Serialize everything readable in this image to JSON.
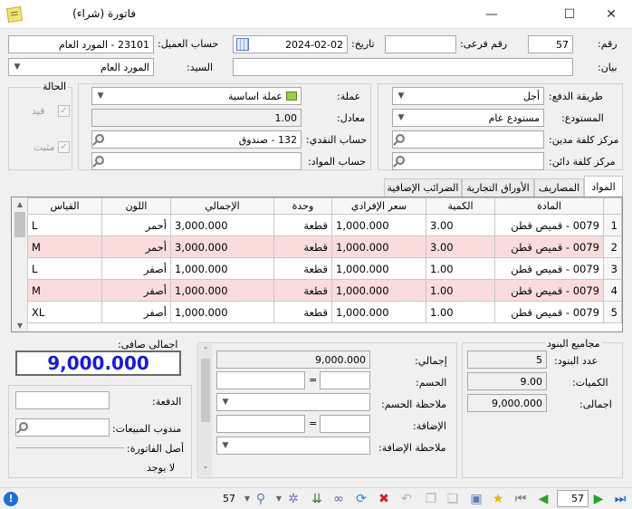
{
  "window": {
    "title": "فاتورة (شراء)",
    "minimize": "—",
    "maximize": "☐",
    "close": "✕"
  },
  "header": {
    "number_label": "رقم:",
    "number": "57",
    "subnumber_label": "رقم فرعى:",
    "subnumber": "",
    "date_label": "تاريخ:",
    "date": "2024-02-02",
    "client_account_label": "حساب العميل:",
    "client_account": "23101 - المورد العام",
    "statement_label": "بيان:",
    "statement": "",
    "mr_label": "السيد:",
    "mr": "المورد العام"
  },
  "right_panel": {
    "payment_method_label": "طريقة الدفع:",
    "payment_method": "أجل",
    "warehouse_label": "المستودع:",
    "warehouse": "مستودع عام",
    "debit_cc_label": "مركز كلفة مدين:",
    "debit_cc": "",
    "credit_cc_label": "مركز كلفة دائن:",
    "credit_cc": ""
  },
  "mid_panel": {
    "currency_label": "عملة:",
    "currency": "عملة اساسية",
    "rate_label": "معادل:",
    "rate": "1.00",
    "cash_account_label": "حساب النقدي:",
    "cash_account": "132 - صندوق",
    "materials_account_label": "حساب المواد:",
    "materials_account": ""
  },
  "status_panel": {
    "title": "الحالة",
    "recorded": "قيد",
    "posted": "مثبت"
  },
  "tabs": [
    "المواد",
    "المصاريف",
    "الأوراق التجارية",
    "الضرائب الإضافية"
  ],
  "grid": {
    "columns": [
      "",
      "المادة",
      "الكمية",
      "سعر الإفرادي",
      "وحدة",
      "الإجمالي",
      "اللون",
      "القياس"
    ],
    "rows": [
      {
        "n": "1",
        "item": "0079 - قميص قطن",
        "qty": "3.00",
        "price": "1,000.000",
        "unit": "قطعة",
        "total": "3,000.000",
        "color": "أحمر",
        "size": "L"
      },
      {
        "n": "2",
        "item": "0079 - قميص قطن",
        "qty": "3.00",
        "price": "1,000.000",
        "unit": "قطعة",
        "total": "3,000.000",
        "color": "أحمر",
        "size": "M"
      },
      {
        "n": "3",
        "item": "0079 - قميص قطن",
        "qty": "1.00",
        "price": "1,000.000",
        "unit": "قطعة",
        "total": "1,000.000",
        "color": "أصفر",
        "size": "L"
      },
      {
        "n": "4",
        "item": "0079 - قميص قطن",
        "qty": "1.00",
        "price": "1,000.000",
        "unit": "قطعة",
        "total": "1,000.000",
        "color": "أصفر",
        "size": "M"
      },
      {
        "n": "5",
        "item": "0079 - قميص قطن",
        "qty": "1.00",
        "price": "1,000.000",
        "unit": "قطعة",
        "total": "1,000.000",
        "color": "أصفر",
        "size": "XL"
      }
    ]
  },
  "totals_box": {
    "title": "مجاميع البنود",
    "count_label": "عدد البنود:",
    "count": "5",
    "qty_label": "الكميات:",
    "qty": "9.00",
    "total_label": "اجمالى:",
    "total": "9,000.000"
  },
  "middle_totals": {
    "total_label": "إجمالي:",
    "total": "9,000.000",
    "discount_label": "الحسم:",
    "discount_note_label": "ملاحظة الحسم:",
    "addition_label": "الإضافة:",
    "addition_note_label": "ملاحظة الإضافة:",
    "eq": "="
  },
  "net": {
    "label": "اجمالى صافى:",
    "value": "9,000.000"
  },
  "left_bottom": {
    "payment_label": "الدفعة:",
    "sales_rep_label": "مندوب المبيعات:",
    "origin_label": "أصل الفاتورة:",
    "origin_value": "لا يوجد"
  },
  "toolbar": {
    "record_number": "57",
    "current": "57"
  }
}
